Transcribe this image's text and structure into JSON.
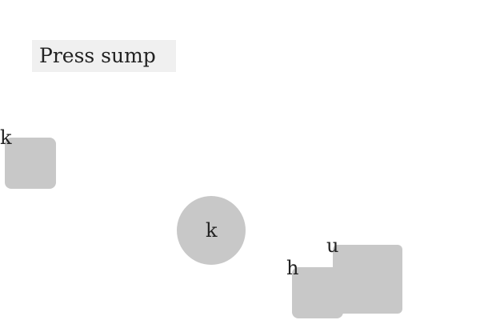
{
  "instruction": {
    "text": "Press sump"
  },
  "targets": [
    {
      "shape": "rounded-square",
      "label": "k",
      "color": "#c8c8c8"
    },
    {
      "shape": "circle",
      "label": "k",
      "color": "#c8c8c8"
    },
    {
      "shape": "rounded-square",
      "label": "u",
      "color": "#c8c8c8"
    },
    {
      "shape": "rounded-square",
      "label": "h",
      "color": "#c8c8c8"
    }
  ]
}
